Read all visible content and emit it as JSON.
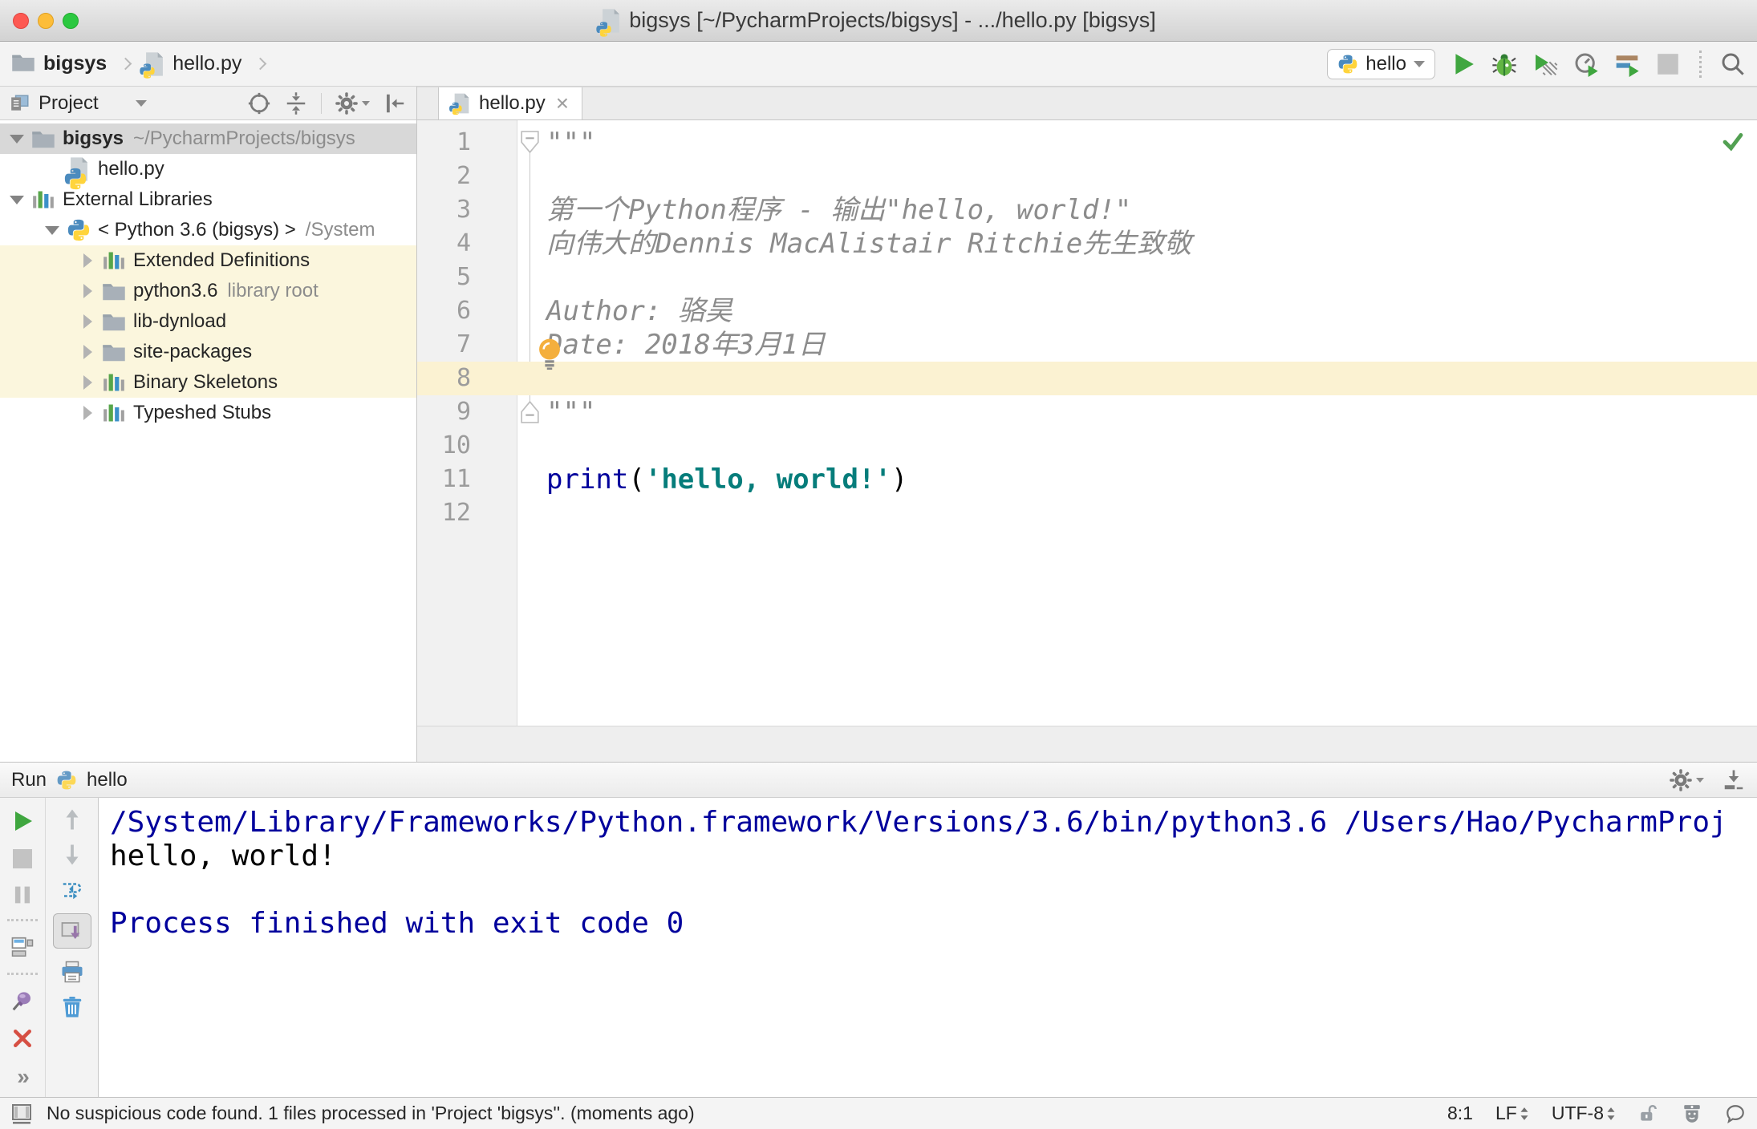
{
  "window": {
    "title": "bigsys [~/PycharmProjects/bigsys] - .../hello.py [bigsys]"
  },
  "toolbar": {
    "breadcrumbs": [
      {
        "label": "bigsys"
      },
      {
        "label": "hello.py"
      }
    ],
    "run_config": "hello"
  },
  "project_panel": {
    "title": "Project",
    "tree": [
      {
        "label": "bigsys",
        "suffix": "~/PycharmProjects/bigsys",
        "icon": "folder",
        "arrow": "down",
        "indent": 0,
        "bold": true,
        "selected": true
      },
      {
        "label": "hello.py",
        "icon": "pyfile",
        "arrow": "none",
        "indent": 1
      },
      {
        "label": "External Libraries",
        "icon": "library",
        "arrow": "down",
        "indent": 0
      },
      {
        "label": "< Python 3.6 (bigsys) >",
        "suffix": "/System",
        "icon": "python",
        "arrow": "down",
        "indent": 1
      },
      {
        "label": "Extended Definitions",
        "icon": "library",
        "arrow": "right",
        "indent": 2,
        "highlight": true
      },
      {
        "label": "python3.6",
        "suffix": "library root",
        "icon": "folder",
        "arrow": "right",
        "indent": 2,
        "highlight": true
      },
      {
        "label": "lib-dynload",
        "icon": "folder",
        "arrow": "right",
        "indent": 2,
        "highlight": true
      },
      {
        "label": "site-packages",
        "icon": "folder",
        "arrow": "right",
        "indent": 2,
        "highlight": true
      },
      {
        "label": "Binary Skeletons",
        "icon": "library",
        "arrow": "right",
        "indent": 2,
        "highlight": true
      },
      {
        "label": "Typeshed Stubs",
        "icon": "library",
        "arrow": "right",
        "indent": 2
      }
    ]
  },
  "editor": {
    "tab": "hello.py",
    "lines": [
      {
        "n": 1,
        "fold": "start",
        "segments": [
          {
            "t": "\"\"\"",
            "c": "doc"
          }
        ]
      },
      {
        "n": 2,
        "segments": []
      },
      {
        "n": 3,
        "segments": [
          {
            "t": "第一个Python程序 - 输出\"hello, world!\"",
            "c": "doc"
          }
        ]
      },
      {
        "n": 4,
        "segments": [
          {
            "t": "向伟大的Dennis MacAlistair Ritchie先生致敬",
            "c": "doc"
          }
        ]
      },
      {
        "n": 5,
        "segments": []
      },
      {
        "n": 6,
        "segments": [
          {
            "t": "Author: 骆昊",
            "c": "doc"
          }
        ]
      },
      {
        "n": 7,
        "bulb": true,
        "segments": [
          {
            "t": "Date: 2018年3月1日",
            "c": "doc"
          }
        ]
      },
      {
        "n": 8,
        "current": true,
        "segments": []
      },
      {
        "n": 9,
        "fold": "end",
        "segments": [
          {
            "t": "\"\"\"",
            "c": "doc"
          }
        ]
      },
      {
        "n": 10,
        "segments": []
      },
      {
        "n": 11,
        "segments": [
          {
            "t": "print",
            "c": "kw"
          },
          {
            "t": "(",
            "c": "plain"
          },
          {
            "t": "'hello, world!'",
            "c": "str"
          },
          {
            "t": ")",
            "c": "plain"
          }
        ]
      },
      {
        "n": 12,
        "segments": []
      }
    ]
  },
  "run_panel": {
    "title": "Run",
    "config": "hello",
    "console": [
      {
        "text": "/System/Library/Frameworks/Python.framework/Versions/3.6/bin/python3.6 /Users/Hao/PycharmProj",
        "color": "sys"
      },
      {
        "text": "hello, world!",
        "color": "out"
      },
      {
        "text": "",
        "color": "out"
      },
      {
        "text": "Process finished with exit code 0",
        "color": "sys"
      }
    ]
  },
  "status_bar": {
    "message": "No suspicious code found. 1 files processed in 'Project 'bigsys''. (moments ago)",
    "position": "8:1",
    "line_ending": "LF",
    "encoding": "UTF-8"
  },
  "colors": {
    "run_green": "#3fa63f",
    "keyword": "#00009c",
    "string": "#067d7b",
    "docstring": "#8c8c8c",
    "current_line": "#fbf2d2",
    "library_highlight": "#fbf6dd",
    "console_system": "#00009c",
    "unfocused_selection": "#d8d8d8"
  }
}
